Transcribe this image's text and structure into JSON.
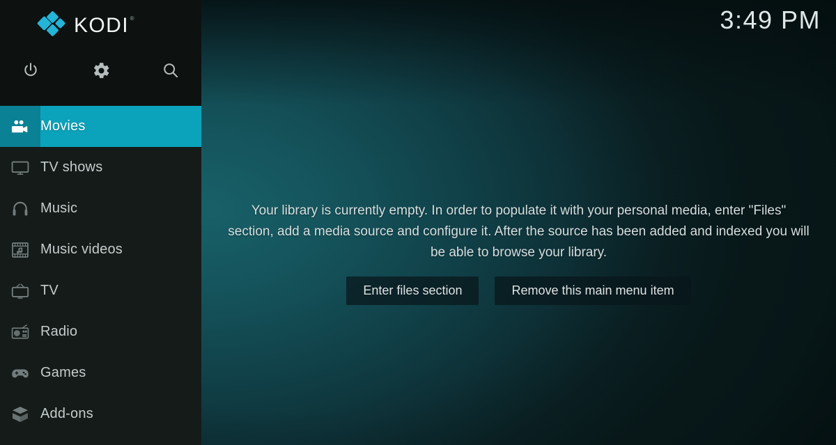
{
  "app": {
    "name": "KODI",
    "trademark": "®",
    "accent_color": "#0ba3bb",
    "accent_dark_color": "#0a8195",
    "sidebar_color": "#151b19",
    "background_color": "#15545c"
  },
  "clock": {
    "time": "3:49 PM"
  },
  "toolbar": {
    "buttons": [
      {
        "name": "power-icon",
        "label": "Power"
      },
      {
        "name": "gear-icon",
        "label": "Settings"
      },
      {
        "name": "search-icon",
        "label": "Search"
      }
    ]
  },
  "sidebar": {
    "items": [
      {
        "label": "Movies",
        "icon": "movie-camera-icon",
        "selected": true
      },
      {
        "label": "TV shows",
        "icon": "tv-monitor-icon",
        "selected": false
      },
      {
        "label": "Music",
        "icon": "headphones-icon",
        "selected": false
      },
      {
        "label": "Music videos",
        "icon": "film-music-icon",
        "selected": false
      },
      {
        "label": "TV",
        "icon": "retro-tv-icon",
        "selected": false
      },
      {
        "label": "Radio",
        "icon": "radio-icon",
        "selected": false
      },
      {
        "label": "Games",
        "icon": "gamepad-icon",
        "selected": false
      },
      {
        "label": "Add-ons",
        "icon": "addon-box-icon",
        "selected": false
      }
    ]
  },
  "main": {
    "empty_message": "Your library is currently empty. In order to populate it with your personal media, enter \"Files\" section, add a media source and configure it. After the source has been added and indexed you will be able to browse your library.",
    "buttons": {
      "enter_files": "Enter files section",
      "remove_item": "Remove this main menu item"
    }
  }
}
